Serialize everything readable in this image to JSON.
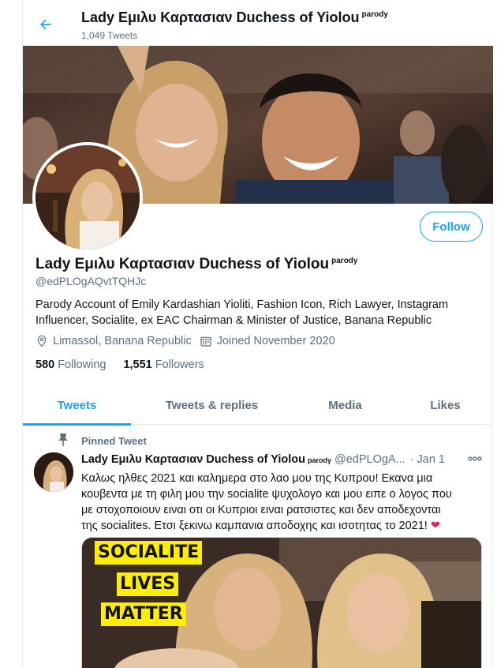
{
  "header": {
    "name": "Lady Εμιλυ Καρτασιαν Duchess of Yiolou",
    "badge": "parody",
    "tweet_count": "1,049 Tweets"
  },
  "profile": {
    "name": "Lady Εμιλυ Καρτασιαν Duchess of Yiolou",
    "badge": "parody",
    "handle": "@edPLOgAQvtTQHJc",
    "bio_line1": "Parody Account of Emily Kardashian Yioliti, Fashion Icon, Rich Lawyer, Instagram",
    "bio_line2": "Influencer, Socialite,  ex EAC Chairman & Minister of Justice, Banana Republic",
    "location": "Limassol, Banana Republic",
    "joined": "Joined November 2020",
    "following_count": "580",
    "following_label": "Following",
    "followers_count": "1,551",
    "followers_label": "Followers",
    "follow_button": "Follow"
  },
  "tabs": [
    {
      "label": "Tweets",
      "active": true
    },
    {
      "label": "Tweets & replies",
      "active": false
    },
    {
      "label": "Media",
      "active": false
    },
    {
      "label": "Likes",
      "active": false
    }
  ],
  "tweet": {
    "pinned_label": "Pinned Tweet",
    "name": "Lady Εμιλυ Καρτασιαν Duchess of Yiolou",
    "badge": "parody",
    "handle": "@edPLOgA...",
    "separator": "·",
    "date": "Jan 1",
    "text_line1": "Καλως ηλθες 2021 και καλημερα στο λαο μου της Κυπρου!  Εκανα μια",
    "text_line2": "κουβεντα με τη φιλη μου την socialite ψυχολογο και μου ειπε ο λογος που",
    "text_line3": "με στοχοποιουν ειναι οτι οι Κυπριοι ειναι ρατσιστες και δεν αποδεχονται",
    "text_line4": "της socialites.  Ετσι ξεκινω καμπανια αποδοχης και ισοτητας το 2021!",
    "heart": "❤",
    "media_caption": [
      "SOCIALITE",
      "LIVES",
      "MATTER"
    ]
  },
  "colors": {
    "accent": "#1da1f2",
    "secondary_text": "#5b7083",
    "heart": "#e0245e",
    "caption_bg": "#ffee00"
  },
  "icons": [
    "back-arrow-icon",
    "location-pin-icon",
    "calendar-icon",
    "pin-icon",
    "more-icon"
  ]
}
